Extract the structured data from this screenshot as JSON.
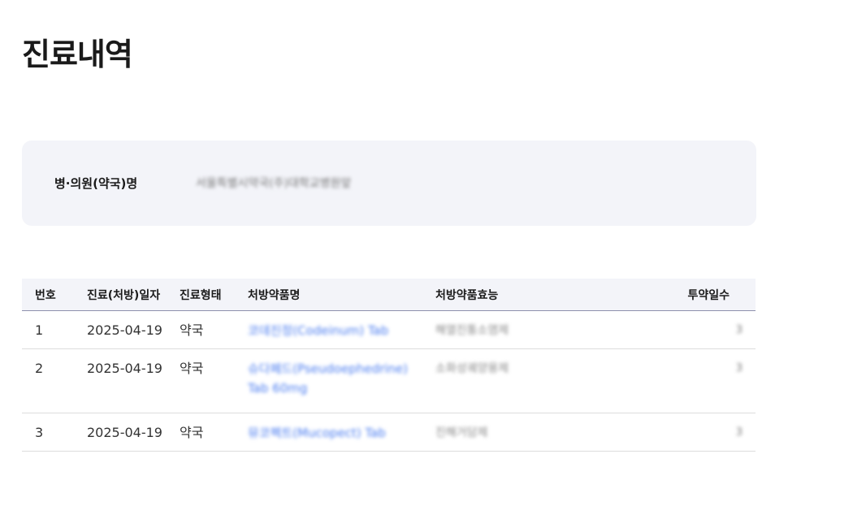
{
  "page": {
    "title": "진료내역"
  },
  "info": {
    "label": "병·의원(약국)명",
    "value": "서울특별시약국(주)대학교병원앞"
  },
  "table": {
    "headers": {
      "no": "번호",
      "date": "진료(처방)일자",
      "type": "진료형태",
      "drug": "처방약품명",
      "effect": "처방약품효능",
      "days": "투약일수"
    },
    "rows": [
      {
        "no": "1",
        "date": "2025-04-19",
        "type": "약국",
        "drug": "코데진정(Codeinum) Tab",
        "effect": "해열진통소염제",
        "days": "3"
      },
      {
        "no": "2",
        "date": "2025-04-19",
        "type": "약국",
        "drug": "슈다페드(Pseudoephedrine) Tab 60mg",
        "effect": "소화성궤양용제",
        "days": "3"
      },
      {
        "no": "3",
        "date": "2025-04-19",
        "type": "약국",
        "drug": "뮤코펙트(Mucopect) Tab",
        "effect": "진해거담제",
        "days": "3"
      }
    ]
  }
}
